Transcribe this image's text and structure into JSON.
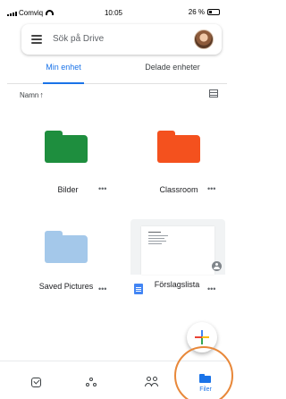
{
  "status_bar": {
    "carrier": "Comviq",
    "time": "10:05",
    "battery": "26 %"
  },
  "search": {
    "placeholder": "Sök på Drive"
  },
  "tabs": [
    {
      "label": "Min enhet",
      "active": true
    },
    {
      "label": "Delade enheter",
      "active": false
    }
  ],
  "sort": {
    "label": "Namn",
    "direction": "↑"
  },
  "items": [
    {
      "name": "Bilder",
      "type": "folder",
      "color": "#1e8e3e"
    },
    {
      "name": "Classroom",
      "type": "folder",
      "color": "#f4511e"
    },
    {
      "name": "Saved Pictures",
      "type": "folder",
      "color": "#a4c8ea"
    },
    {
      "name": "Förslagslista",
      "type": "document",
      "color": "#4285f4"
    }
  ],
  "more_label": "•••",
  "bottom_nav": {
    "files_label": "Filer"
  },
  "colors": {
    "accent": "#1a73e8",
    "highlight": "#e8883a"
  }
}
